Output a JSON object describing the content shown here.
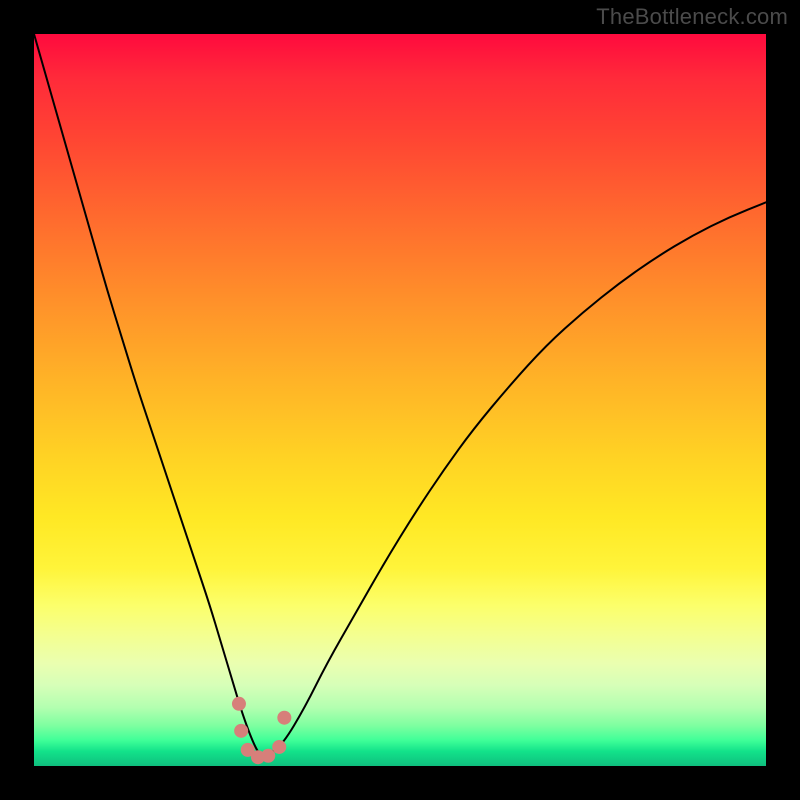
{
  "watermark_text": "TheBottleneck.com",
  "chart_data": {
    "type": "line",
    "title": "",
    "xlabel": "",
    "ylabel": "",
    "xlim": [
      0,
      100
    ],
    "ylim": [
      0,
      100
    ],
    "grid": false,
    "legend": false,
    "background": {
      "kind": "vertical-gradient",
      "meaning": "bottleneck severity (red high → green low)",
      "stops": [
        {
          "pct": 0,
          "color": "#ff0a3e"
        },
        {
          "pct": 50,
          "color": "#ffb227"
        },
        {
          "pct": 78,
          "color": "#fcff6a"
        },
        {
          "pct": 100,
          "color": "#0fbf7e"
        }
      ]
    },
    "series": [
      {
        "name": "bottleneck-curve",
        "color": "#000000",
        "stroke_width": 2,
        "x": [
          0,
          2,
          4,
          6,
          8,
          10,
          12,
          14,
          16,
          18,
          20,
          22,
          24,
          25.5,
          27,
          28.5,
          30,
          31,
          32,
          34,
          37,
          40,
          44,
          48,
          52,
          56,
          60,
          65,
          70,
          75,
          80,
          85,
          90,
          95,
          100
        ],
        "y": [
          100,
          93,
          86,
          79,
          72,
          65,
          58.5,
          52,
          46,
          40,
          34,
          28,
          22,
          17,
          12,
          7,
          3,
          1.3,
          1.5,
          3,
          8,
          14,
          21,
          28,
          34.5,
          40.5,
          46,
          52,
          57.5,
          62,
          66,
          69.5,
          72.5,
          75,
          77
        ]
      }
    ],
    "markers": [
      {
        "name": "min-region-point",
        "x": 28.0,
        "y": 8.5,
        "color": "#d77f7a",
        "r": 7
      },
      {
        "name": "min-region-point",
        "x": 28.3,
        "y": 4.8,
        "color": "#d77f7a",
        "r": 7
      },
      {
        "name": "min-region-point",
        "x": 29.2,
        "y": 2.2,
        "color": "#d77f7a",
        "r": 7
      },
      {
        "name": "min-region-point",
        "x": 30.6,
        "y": 1.2,
        "color": "#d77f7a",
        "r": 7
      },
      {
        "name": "min-region-point",
        "x": 32.0,
        "y": 1.4,
        "color": "#d77f7a",
        "r": 7
      },
      {
        "name": "min-region-point",
        "x": 33.5,
        "y": 2.6,
        "color": "#d77f7a",
        "r": 7
      },
      {
        "name": "min-region-point",
        "x": 34.2,
        "y": 6.6,
        "color": "#d77f7a",
        "r": 7
      }
    ]
  }
}
